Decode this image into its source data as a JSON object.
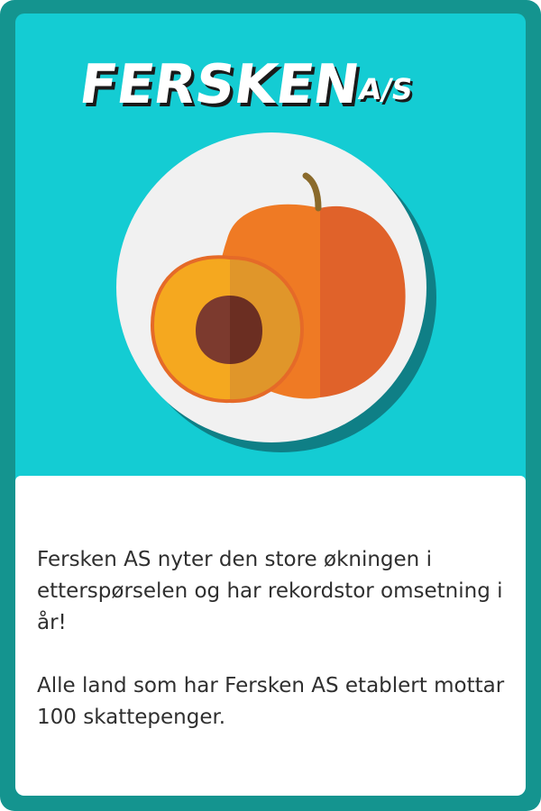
{
  "card": {
    "title": "FERSKEN",
    "title_suffix": "A/S",
    "body": [
      "Fersken AS nyter den store økningen i etterspørselen og har rekordstor omsetning i år!",
      "Alle land som har Fersken AS etablert mottar 100 skattepenger."
    ],
    "illustration_icon": "peach-icon",
    "colors": {
      "border": "#14948f",
      "background": "#14ccd3",
      "title": "#ffffff",
      "title_shadow": "#1a1a1a",
      "plate": "#f1f1f1",
      "peach": "#ef7a24",
      "peach_flesh": "#f5a81f",
      "pit": "#7c3a2e"
    }
  }
}
